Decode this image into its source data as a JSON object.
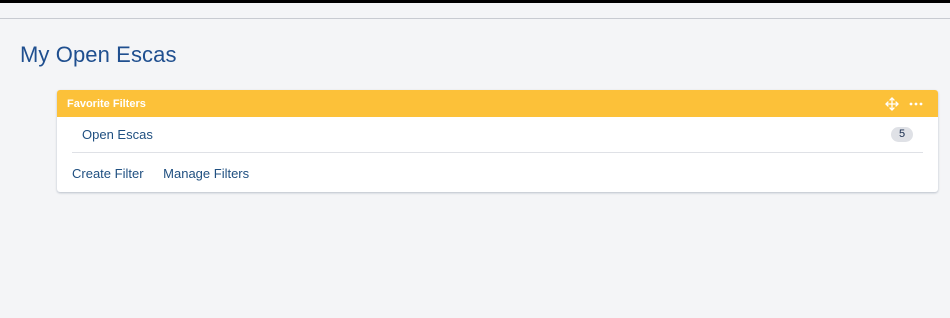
{
  "page": {
    "title": "My Open Escas"
  },
  "gadget": {
    "title": "Favorite Filters",
    "header_color": "#fcc139",
    "actions": [
      {
        "icon": "move-icon"
      },
      {
        "icon": "more-icon"
      }
    ],
    "filters": [
      {
        "name": "Open Escas",
        "count": "5"
      }
    ],
    "footer": {
      "create_label": "Create Filter",
      "manage_label": "Manage Filters"
    }
  },
  "colors": {
    "link": "#205081",
    "title": "#1f4f8f",
    "background": "#f4f5f7"
  }
}
